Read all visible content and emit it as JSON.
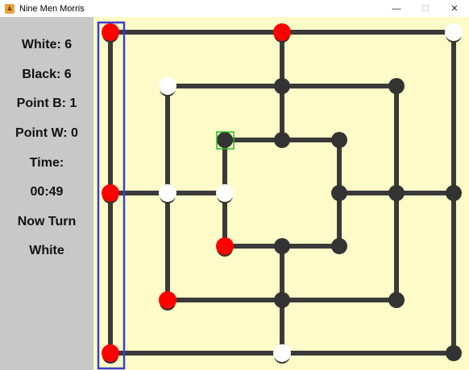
{
  "window": {
    "title": "Nine Men Morris",
    "icon": "game-app-icon",
    "minimize_glyph": "—",
    "maximize_glyph": "☐",
    "close_glyph": "✕"
  },
  "status": {
    "white": "White: 6",
    "black": "Black: 6",
    "point_b": "Point B: 1",
    "point_w": "Point W: 0",
    "time_label": "Time:",
    "time_value": "00:49",
    "turn_label": "Now Turn",
    "turn_value": "White"
  },
  "colors": {
    "board_bg": "#fdfbc7",
    "line": "#3a3a3a",
    "red": "#ff0000",
    "white": "#ffffff",
    "black": "#333333",
    "highlight_column": "#3d3dcc",
    "selected": "#22bb22"
  },
  "board": {
    "rows": [
      "a7",
      "d7",
      "g7",
      "b6",
      "d6",
      "f6",
      "c5",
      "d5",
      "e5",
      "a4",
      "b4",
      "c4",
      "e4",
      "f4",
      "g4",
      "c3",
      "d3",
      "e3",
      "b2",
      "d2",
      "f2",
      "a1",
      "d1",
      "g1"
    ],
    "pieces": [
      {
        "pos": "a7",
        "color": "red"
      },
      {
        "pos": "d7",
        "color": "red"
      },
      {
        "pos": "g7",
        "color": "white"
      },
      {
        "pos": "b6",
        "color": "white"
      },
      {
        "pos": "d6",
        "color": "black"
      },
      {
        "pos": "f6",
        "color": "black"
      },
      {
        "pos": "c5",
        "color": "black"
      },
      {
        "pos": "d5",
        "color": "black"
      },
      {
        "pos": "e5",
        "color": "black"
      },
      {
        "pos": "a4",
        "color": "red"
      },
      {
        "pos": "b4",
        "color": "white"
      },
      {
        "pos": "c4",
        "color": "white"
      },
      {
        "pos": "e4",
        "color": "black"
      },
      {
        "pos": "f4",
        "color": "black"
      },
      {
        "pos": "g4",
        "color": "black"
      },
      {
        "pos": "c3",
        "color": "red"
      },
      {
        "pos": "d3",
        "color": "black"
      },
      {
        "pos": "e3",
        "color": "black"
      },
      {
        "pos": "b2",
        "color": "red"
      },
      {
        "pos": "d2",
        "color": "black"
      },
      {
        "pos": "f2",
        "color": "black"
      },
      {
        "pos": "a1",
        "color": "red"
      },
      {
        "pos": "d1",
        "color": "white"
      },
      {
        "pos": "g1",
        "color": "black"
      }
    ],
    "selected_point": "c5",
    "highlighted_column": "a"
  }
}
